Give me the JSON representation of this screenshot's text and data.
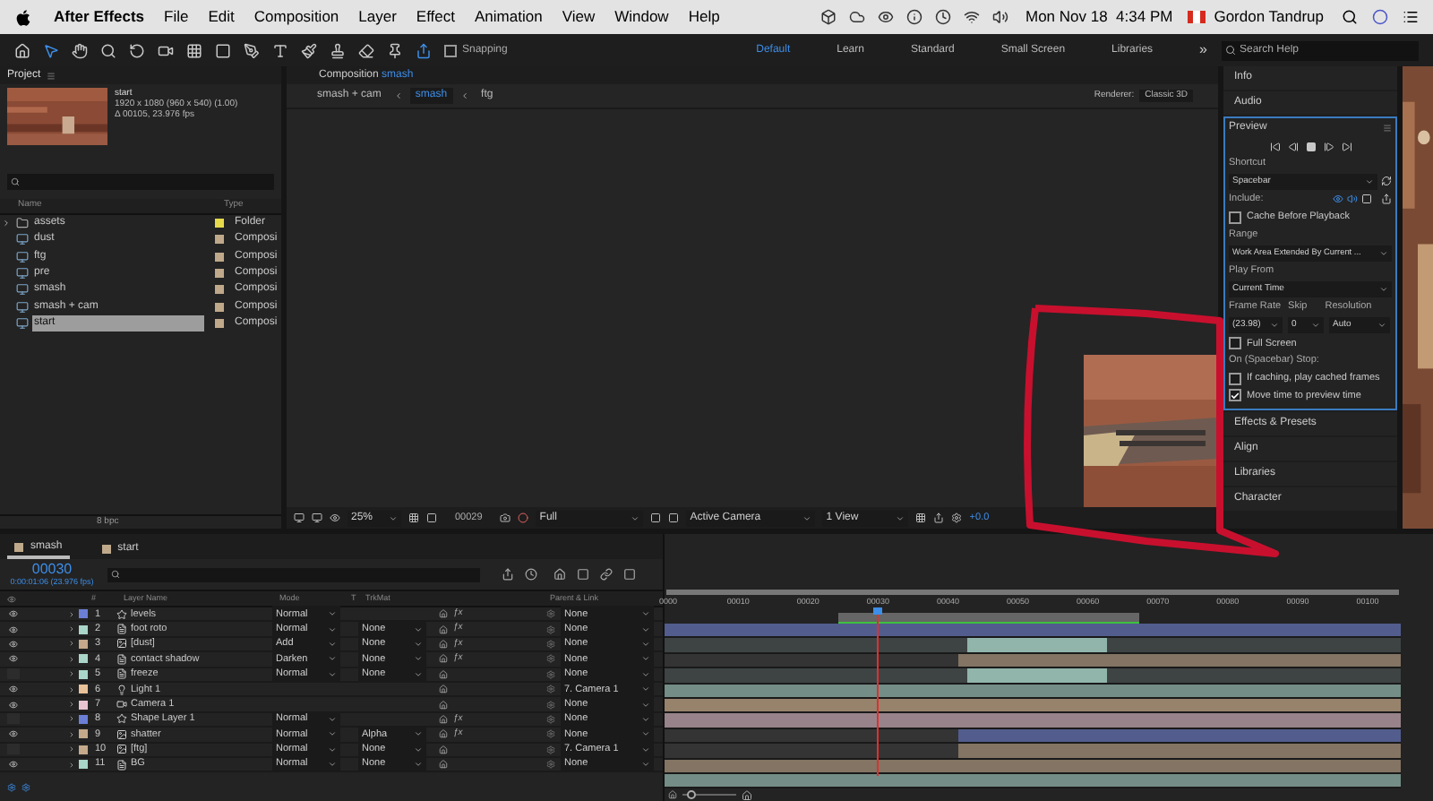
{
  "menubar": {
    "app": "After Effects",
    "items": [
      "File",
      "Edit",
      "Composition",
      "Layer",
      "Effect",
      "Animation",
      "View",
      "Window",
      "Help"
    ],
    "clock": "Mon Nov 18  4:34 PM",
    "user": "Gordon Tandrup"
  },
  "toolbar": {
    "snapping": {
      "label": "Snapping",
      "checked": false
    },
    "workspaces": [
      {
        "label": "Default",
        "selected": true
      },
      {
        "label": "Learn",
        "selected": false
      },
      {
        "label": "Standard",
        "selected": false
      },
      {
        "label": "Small Screen",
        "selected": false
      },
      {
        "label": "Libraries",
        "selected": false
      }
    ],
    "more": "»",
    "search_placeholder": "Search Help"
  },
  "project": {
    "title": "Project",
    "item_name": "start",
    "info": [
      "1920 x 1080  (960 x 540) (1.00)",
      "Δ 00105, 23.976 fps"
    ],
    "columns": [
      "Name",
      "Type"
    ],
    "items": [
      {
        "name": "assets",
        "type": "Folder",
        "kind": "folder",
        "color": "#e6d94a",
        "selected": false
      },
      {
        "name": "dust",
        "type": "Composi",
        "kind": "comp",
        "color": "#bfa98a",
        "selected": false
      },
      {
        "name": "ftg",
        "type": "Composi",
        "kind": "comp",
        "color": "#bfa98a",
        "selected": false
      },
      {
        "name": "pre",
        "type": "Composi",
        "kind": "comp",
        "color": "#bfa98a",
        "selected": false
      },
      {
        "name": "smash",
        "type": "Composi",
        "kind": "comp",
        "color": "#bfa98a",
        "selected": false
      },
      {
        "name": "smash + cam",
        "type": "Composi",
        "kind": "comp",
        "color": "#bfa98a",
        "selected": false
      },
      {
        "name": "start",
        "type": "Composi",
        "kind": "comp",
        "color": "#bfa98a",
        "selected": true
      }
    ],
    "bpc": "8 bpc"
  },
  "composition": {
    "tab_label": "Composition",
    "comp_name": "smash",
    "breadcrumbs": [
      {
        "label": "smash + cam",
        "selected": false
      },
      {
        "label": "smash",
        "selected": true
      },
      {
        "label": "ftg",
        "selected": false
      }
    ],
    "renderer_label": "Renderer:",
    "renderer": "Classic 3D",
    "zoom": "25%",
    "timecode": "00029",
    "resolution": "Full",
    "camera": "Active Camera",
    "views": "1 View",
    "exposure": "+0.0"
  },
  "right_panel": {
    "tabs": [
      "Info",
      "Audio"
    ],
    "preview": {
      "title": "Preview",
      "shortcut_label": "Shortcut",
      "shortcut": "Spacebar",
      "include_label": "Include:",
      "cache_before": {
        "label": "Cache Before Playback",
        "checked": false
      },
      "range_label": "Range",
      "range": "Work Area Extended By Current ...",
      "play_from_label": "Play From",
      "play_from": "Current Time",
      "frame_rate_label": "Frame Rate",
      "skip_label": "Skip",
      "resolution_label": "Resolution",
      "frame_rate": "(23.98)",
      "skip": "0",
      "resolution": "Auto",
      "full_screen": {
        "label": "Full Screen",
        "checked": false
      },
      "stop_label": "On (Spacebar) Stop:",
      "options": [
        {
          "label": "If caching, play cached frames",
          "checked": false
        },
        {
          "label": "Move time to preview time",
          "checked": true
        }
      ]
    },
    "panels": [
      "Effects & Presets",
      "Align",
      "Libraries",
      "Character"
    ]
  },
  "timeline": {
    "tabs": [
      {
        "label": "smash",
        "selected": true,
        "color": "#bfa98a"
      },
      {
        "label": "start",
        "selected": false,
        "color": "#bfa98a"
      }
    ],
    "timecode": "00030",
    "timecode_detail": "0:00:01:06 (23.976 fps)",
    "columns": {
      "number": "#",
      "name": "Layer Name",
      "mode": "Mode",
      "t": "T",
      "trkmat": "TrkMat",
      "parent": "Parent & Link"
    },
    "ruler": [
      "0000",
      "00010",
      "00020",
      "00030",
      "00040",
      "00050",
      "00060",
      "00070",
      "00080",
      "00090",
      "00100"
    ],
    "zoom_slider": {
      "level": 0.15
    },
    "layers": [
      {
        "number": "1",
        "name": "levels",
        "kind": "shape",
        "color": "#6b7fd6",
        "visible": true,
        "mode": "Normal",
        "fx": "ƒx",
        "parent": "None",
        "bar": {
          "kind": "full"
        }
      },
      {
        "number": "2",
        "name": "foot roto",
        "kind": "solid",
        "color": "#a9d6c9",
        "visible": true,
        "mode": "Normal",
        "trkmat": "None",
        "fx": "ƒx",
        "parent": "None",
        "bar": {
          "kind": "segment"
        }
      },
      {
        "number": "3",
        "name": "[dust]",
        "kind": "precomp",
        "color": "#c4a98a",
        "visible": true,
        "mode": "Add",
        "trkmat": "None",
        "fx": "ƒx",
        "parent": "None",
        "bar": {
          "kind": "late"
        }
      },
      {
        "number": "4",
        "name": "contact shadow",
        "kind": "solid",
        "color": "#a9d6c9",
        "visible": true,
        "mode": "Darken",
        "trkmat": "None",
        "fx": "ƒx",
        "parent": "None",
        "bar": {
          "kind": "segment"
        }
      },
      {
        "number": "5",
        "name": "freeze",
        "kind": "solid",
        "color": "#a9d6c9",
        "visible": false,
        "mode": "Normal",
        "trkmat": "None",
        "parent": "None",
        "bar": {
          "kind": "full"
        }
      },
      {
        "number": "6",
        "name": "Light 1",
        "kind": "light",
        "color": "#e9c29a",
        "visible": true,
        "parent": "7. Camera 1",
        "bar": {
          "kind": "full"
        }
      },
      {
        "number": "7",
        "name": "Camera 1",
        "kind": "camera",
        "color": "#e8c4d0",
        "visible": true,
        "parent": "None",
        "bar": {
          "kind": "full"
        }
      },
      {
        "number": "8",
        "name": "Shape Layer 1",
        "kind": "shape",
        "color": "#6b7fd6",
        "visible": false,
        "mode": "Normal",
        "fx": "ƒx",
        "parent": "None",
        "bar": {
          "kind": "late"
        }
      },
      {
        "number": "9",
        "name": "shatter",
        "kind": "precomp",
        "color": "#c4a98a",
        "visible": true,
        "mode": "Normal",
        "trkmat": "Alpha",
        "fx": "ƒx",
        "parent": "None",
        "bar": {
          "kind": "late"
        }
      },
      {
        "number": "10",
        "name": "[ftg]",
        "kind": "precomp",
        "color": "#c4a98a",
        "visible": false,
        "mode": "Normal",
        "trkmat": "None",
        "parent": "7. Camera 1",
        "bar": {
          "kind": "full"
        }
      },
      {
        "number": "11",
        "name": "BG",
        "kind": "solid",
        "color": "#a9d6c9",
        "visible": true,
        "mode": "Normal",
        "trkmat": "None",
        "parent": "None",
        "bar": {
          "kind": "full"
        }
      }
    ]
  }
}
